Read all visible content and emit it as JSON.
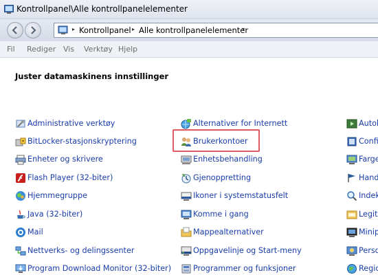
{
  "window": {
    "title": "Kontrollpanel\\Alle kontrollpanelelementer"
  },
  "address": {
    "crumbs": [
      "Kontrollpanel",
      "Alle kontrollpanelelementer"
    ]
  },
  "menu": [
    "Fil",
    "Rediger",
    "Vis",
    "Verktøy",
    "Hjelp"
  ],
  "heading": "Juster datamaskinens innstillinger",
  "columns": {
    "col1": [
      {
        "label": "Administrative verktøy",
        "icon": "admin-tools-icon"
      },
      {
        "label": "BitLocker-stasjonskryptering",
        "icon": "bitlocker-icon"
      },
      {
        "label": "Enheter og skrivere",
        "icon": "printer-icon"
      },
      {
        "label": "Flash Player (32-biter)",
        "icon": "flash-icon"
      },
      {
        "label": "Hjemmegruppe",
        "icon": "homegroup-icon"
      },
      {
        "label": "Java (32-biter)",
        "icon": "java-icon"
      },
      {
        "label": "Mail",
        "icon": "mail-icon"
      },
      {
        "label": "Nettverks- og delingssenter",
        "icon": "network-icon"
      },
      {
        "label": "Program Download Monitor (32-biter)",
        "icon": "download-monitor-icon"
      }
    ],
    "col2": [
      {
        "label": "Alternativer for Internett",
        "icon": "internet-options-icon"
      },
      {
        "label": "Brukerkontoer",
        "icon": "users-icon"
      },
      {
        "label": "Enhetsbehandling",
        "icon": "device-manager-icon"
      },
      {
        "label": "Gjenoppretting",
        "icon": "recovery-icon"
      },
      {
        "label": "Ikoner i systemstatusfelt",
        "icon": "tray-icons-icon"
      },
      {
        "label": "Komme i gang",
        "icon": "getting-started-icon"
      },
      {
        "label": "Mappealternativer",
        "icon": "folder-options-icon"
      },
      {
        "label": "Oppgavelinje og Start-meny",
        "icon": "taskbar-icon"
      },
      {
        "label": "Programmer og funksjoner",
        "icon": "programs-icon"
      }
    ],
    "col3": [
      {
        "label": "Autok",
        "icon": "autoplay-icon"
      },
      {
        "label": "Config",
        "icon": "config-icon"
      },
      {
        "label": "Farge",
        "icon": "color-icon"
      },
      {
        "label": "Handli",
        "icon": "action-center-icon"
      },
      {
        "label": "Indeks",
        "icon": "indexing-icon"
      },
      {
        "label": "Legitim",
        "icon": "credentials-icon"
      },
      {
        "label": "Minipr",
        "icon": "programs-mini-icon"
      },
      {
        "label": "Person",
        "icon": "personalize-icon"
      },
      {
        "label": "Region",
        "icon": "region-icon"
      }
    ]
  },
  "colors": {
    "link": "#1a3da8",
    "highlight": "#e05a62"
  }
}
